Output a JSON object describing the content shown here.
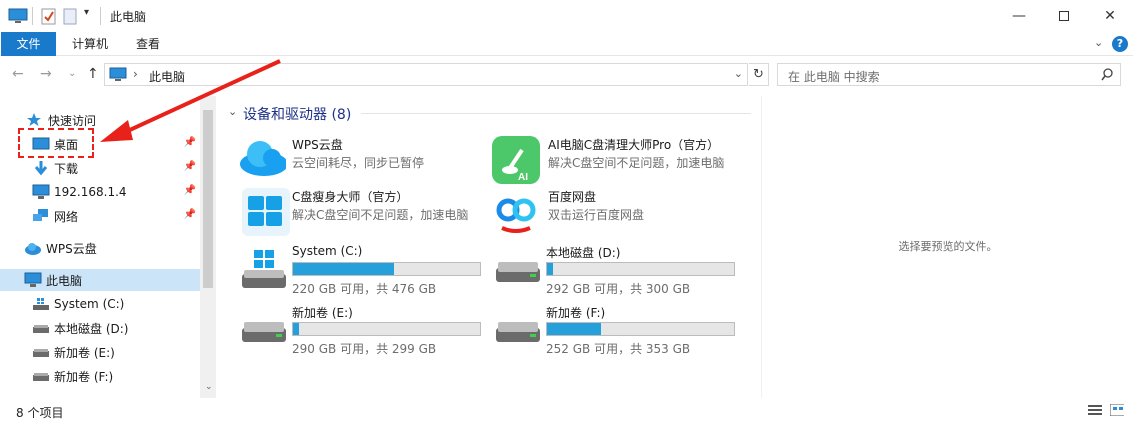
{
  "window": {
    "title": "此电脑",
    "minimize_icon": "minimize-icon",
    "maximize_icon": "maximize-icon",
    "close_icon": "close-icon"
  },
  "ribbon": {
    "tabs": [
      "文件",
      "计算机",
      "查看"
    ]
  },
  "address": {
    "path": "此电脑",
    "search_placeholder": "在 此电脑 中搜索"
  },
  "nav": {
    "items": [
      {
        "label": "快速访问"
      },
      {
        "label": "桌面"
      },
      {
        "label": "下载"
      },
      {
        "label": "192.168.1.4"
      },
      {
        "label": "网络"
      },
      {
        "label": "WPS云盘"
      },
      {
        "label": "此电脑"
      },
      {
        "label": "System (C:)"
      },
      {
        "label": "本地磁盘 (D:)"
      },
      {
        "label": "新加卷 (E:)"
      },
      {
        "label": "新加卷 (F:)"
      }
    ]
  },
  "main": {
    "group_header": "设备和驱动器 (8)",
    "apps": [
      {
        "name": "WPS云盘",
        "sub": "云空间耗尽，同步已暂停"
      },
      {
        "name": "AI电脑C盘清理大师Pro（官方）",
        "sub": "解决C盘空间不足问题，加速电脑"
      },
      {
        "name": "C盘瘦身大师（官方）",
        "sub": "解决C盘空间不足问题，加速电脑"
      },
      {
        "name": "百度网盘",
        "sub": "双击运行百度网盘"
      }
    ],
    "drives": [
      {
        "name": "System (C:)",
        "usage": "220 GB 可用，共 476 GB",
        "used_fraction": 0.54
      },
      {
        "name": "本地磁盘 (D:)",
        "usage": "292 GB 可用，共 300 GB",
        "used_fraction": 0.03
      },
      {
        "name": "新加卷 (E:)",
        "usage": "290 GB 可用，共 299 GB",
        "used_fraction": 0.03
      },
      {
        "name": "新加卷 (F:)",
        "usage": "252 GB 可用，共 353 GB",
        "used_fraction": 0.29
      }
    ]
  },
  "preview": {
    "message": "选择要预览的文件。"
  },
  "status": {
    "count": "8 个项目"
  },
  "colors": {
    "accent": "#1979ca",
    "bar_fill": "#26a0da",
    "annotation": "#e8221b"
  }
}
